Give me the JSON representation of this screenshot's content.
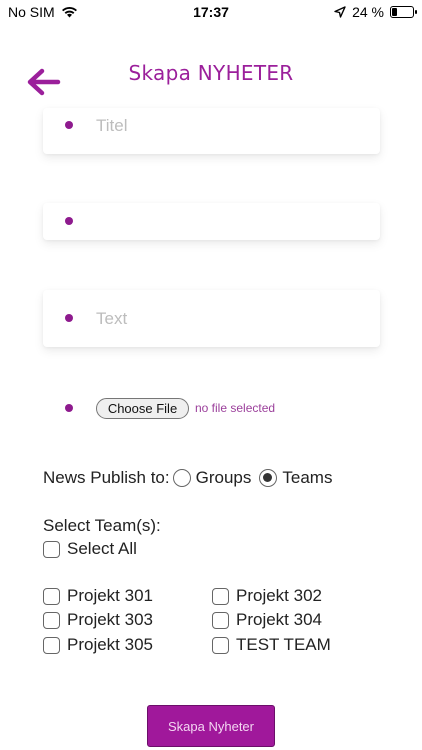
{
  "status_bar": {
    "carrier": "No SIM",
    "time": "17:37",
    "battery": "24 %"
  },
  "header": {
    "title": "Skapa NYHETER"
  },
  "form": {
    "title_placeholder": "Titel",
    "second_value": "",
    "text_placeholder": "Text",
    "file_button": "Choose File",
    "file_status": "no file selected",
    "publish_label": "News Publish to:",
    "publish_options": [
      {
        "label": "Groups",
        "selected": false
      },
      {
        "label": "Teams",
        "selected": true
      }
    ],
    "select_teams_label": "Select Team(s):",
    "select_all_label": "Select All",
    "teams": [
      {
        "label": "Projekt 301",
        "checked": false
      },
      {
        "label": "Projekt 302",
        "checked": false
      },
      {
        "label": "Projekt 303",
        "checked": false
      },
      {
        "label": "Projekt 304",
        "checked": false
      },
      {
        "label": "Projekt 305",
        "checked": false
      },
      {
        "label": "TEST TEAM",
        "checked": false
      }
    ],
    "submit_label": "Skapa Nyheter"
  },
  "colors": {
    "accent": "#9b1f9b",
    "button": "#a0189b"
  }
}
